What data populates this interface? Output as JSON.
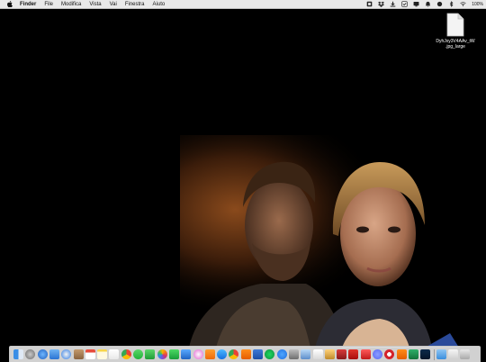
{
  "menubar": {
    "app_name": "Finder",
    "items": [
      "File",
      "Modifica",
      "Vista",
      "Vai",
      "Finestra",
      "Aiuto"
    ],
    "battery": "100%"
  },
  "desktop": {
    "file_name": "DyhJxy3V4AAv_tW\n.jpg_large"
  },
  "colors": {
    "menubar_bg": "#e9e9e9",
    "dock_bg": "#e1e1e1",
    "desktop_bg": "#000000"
  },
  "dock": {
    "icons": [
      "finder-icon",
      "launchpad-icon",
      "safari-compass-icon",
      "mail-icon",
      "browser-icon",
      "contacts-icon",
      "calendar-icon",
      "notes-icon",
      "reminders-icon",
      "chrome-icon",
      "messages-icon",
      "facetime-icon",
      "photos-icon",
      "numbers-icon",
      "keynote-icon",
      "itunes-icon",
      "books-icon",
      "app-store-icon",
      "chrome-icon",
      "vlc-icon",
      "word-icon",
      "spotify-icon",
      "messenger-icon",
      "utility-icon",
      "preview-icon",
      "accessibility-icon",
      "paint-icon",
      "photo-booth-icon",
      "acrobat-icon",
      "adobe-icon",
      "discord-icon",
      "opera-icon",
      "vlc-icon",
      "excel-icon",
      "photoshop-icon",
      "downloads-folder-icon",
      "documents-icon",
      "trash-icon"
    ]
  }
}
